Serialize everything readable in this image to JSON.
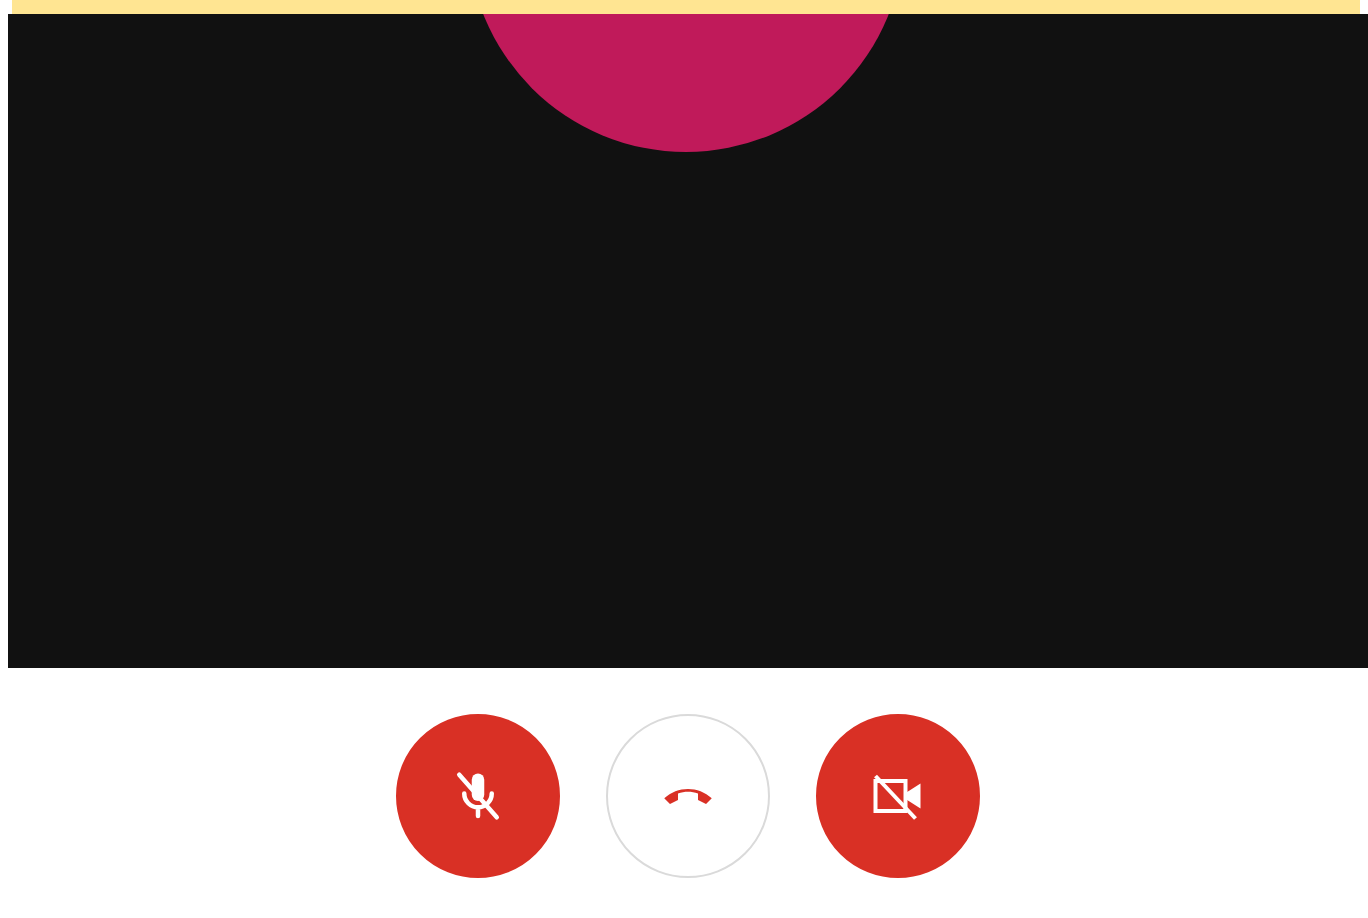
{
  "controls": [
    {
      "kind": "microphone",
      "muted": true
    },
    {
      "kind": "hangup"
    },
    {
      "kind": "camera",
      "muted": true
    }
  ]
}
